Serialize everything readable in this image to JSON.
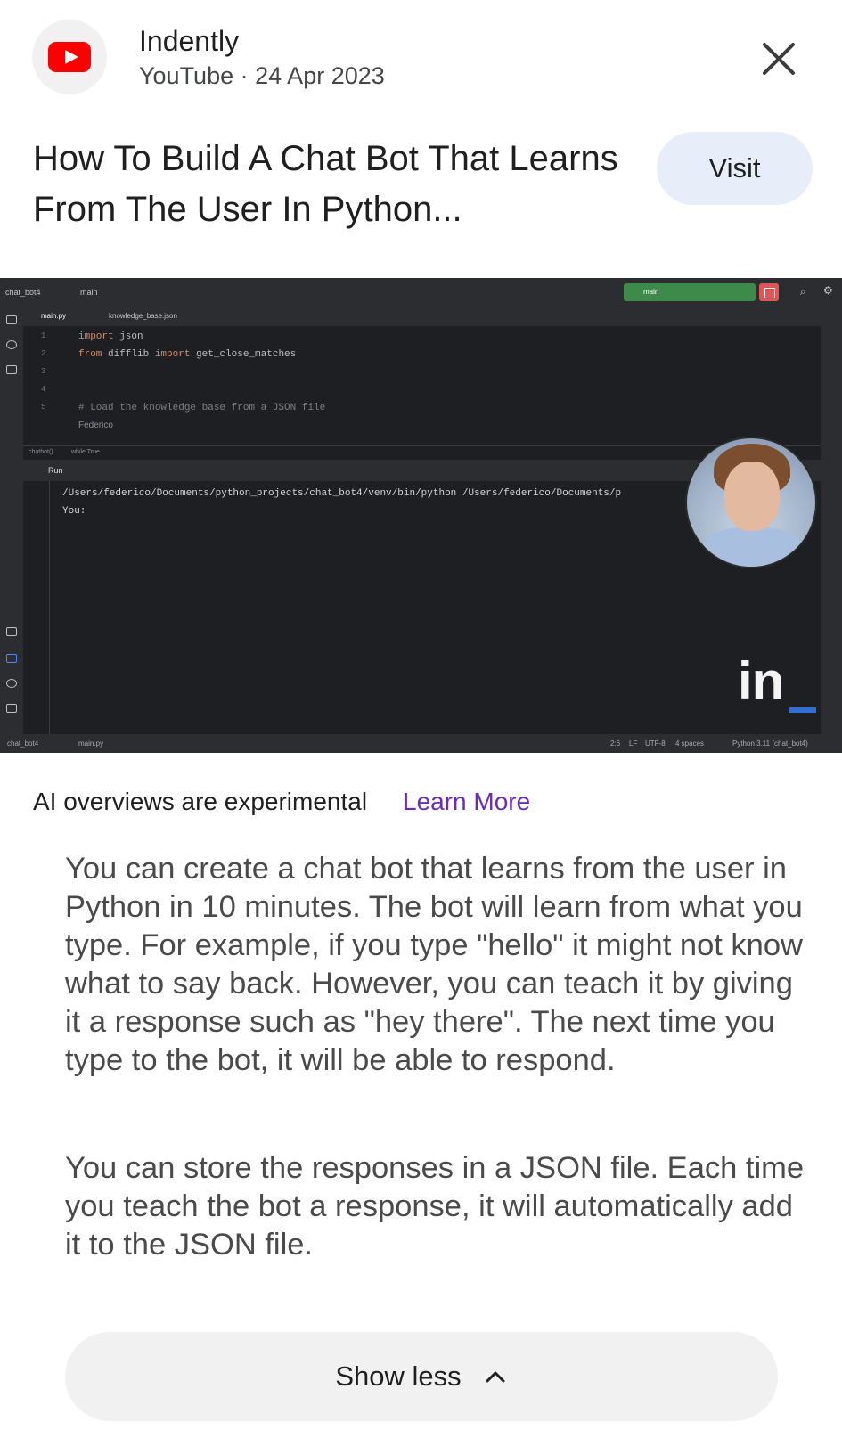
{
  "header": {
    "channel": "Indently",
    "source": "YouTube",
    "separator": "·",
    "date": "24 Apr 2023",
    "title": "How To Build A Chat Bot That Learns From The User In Python...",
    "visit_label": "Visit",
    "icons": {
      "logo": "youtube-logo-icon",
      "close": "close-icon"
    }
  },
  "thumbnail": {
    "project": "chat_bot4",
    "branch": "main",
    "run_branch": "main",
    "tab_active": "main.py",
    "tab_other": "knowledge_base.json",
    "code_lines": [
      {
        "num": "1",
        "kw": "import",
        "rest": " json"
      },
      {
        "num": "2",
        "kw": "from",
        "rest": " difflib ",
        "kw2": "import",
        "rest2": " get_close_matches"
      },
      {
        "num": "3"
      },
      {
        "num": "4"
      },
      {
        "num": "5",
        "comment": "# Load the knowledge base from a JSON file"
      }
    ],
    "author": "Federico",
    "crumb_fn": "chatbot()",
    "crumb_loop": "while True",
    "run_label": "Run",
    "console_line1": "/Users/federico/Documents/python_projects/chat_bot4/venv/bin/python /Users/federico/Documents/p",
    "console_line2": "You:",
    "status_path": "chat_bot4",
    "status_file": "main.py",
    "status_pos": "2:6",
    "status_lf": "LF",
    "status_enc": "UTF-8",
    "status_indent": "4 spaces",
    "status_interp": "Python 3.11 (chat_bot4)",
    "brand": "in",
    "brand_color": "#2f6fd6"
  },
  "overview": {
    "notice": "AI overviews are experimental",
    "learn_more": "Learn More",
    "paragraphs": [
      "You can create a chat bot that learns from the user in Python in 10 minutes. The bot will learn from what you type. For example, if you type \"hello\" it might not know what to say back. However, you can teach it by giving it a response such as \"hey there\". The next time you type to the bot, it will be able to respond.",
      "You can store the responses in a JSON file. Each time you teach the bot a response, it will automatically add it to the JSON file."
    ],
    "show_less": "Show less",
    "show_less_icon": "chevron-up-icon",
    "accent": "#6c2ab7"
  }
}
